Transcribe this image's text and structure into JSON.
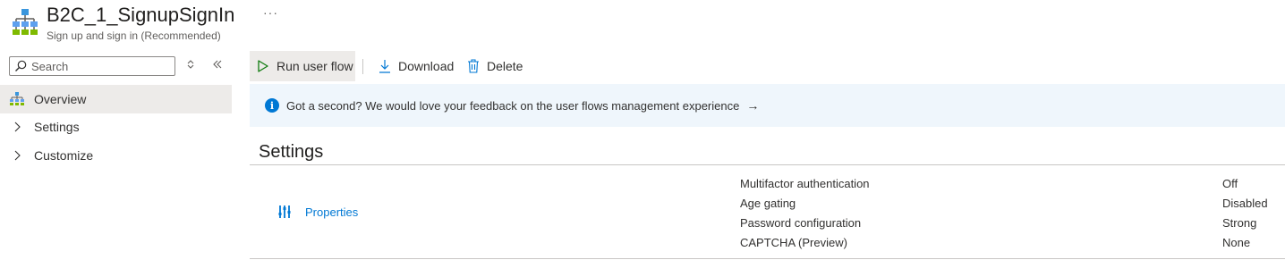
{
  "header": {
    "title": "B2C_1_SignupSignIn",
    "subtitle": "Sign up and sign in (Recommended)",
    "more_label": "···",
    "icon": "user-flow-hierarchy-icon"
  },
  "nav": {
    "search_placeholder": "Search",
    "items": [
      {
        "label": "Overview",
        "icon": "user-flow-hierarchy-icon",
        "active": true
      },
      {
        "label": "Settings",
        "icon": "chevron-right-icon",
        "active": false
      },
      {
        "label": "Customize",
        "icon": "chevron-right-icon",
        "active": false
      }
    ]
  },
  "toolbar": {
    "run_label": "Run user flow",
    "download_label": "Download",
    "delete_label": "Delete"
  },
  "banner": {
    "text": "Got a second? We would love your feedback on the user flows management experience",
    "arrow": "→"
  },
  "settings": {
    "title": "Settings",
    "link_label": "Properties",
    "rows": [
      {
        "label": "Multifactor authentication",
        "value": "Off"
      },
      {
        "label": "Age gating",
        "value": "Disabled"
      },
      {
        "label": "Password configuration",
        "value": "Strong"
      },
      {
        "label": "CAPTCHA (Preview)",
        "value": "None"
      }
    ]
  },
  "colors": {
    "accent": "#0078d4",
    "run_green": "#107c10",
    "banner_bg": "#eff6fc",
    "selected_bg": "#edebe9"
  }
}
